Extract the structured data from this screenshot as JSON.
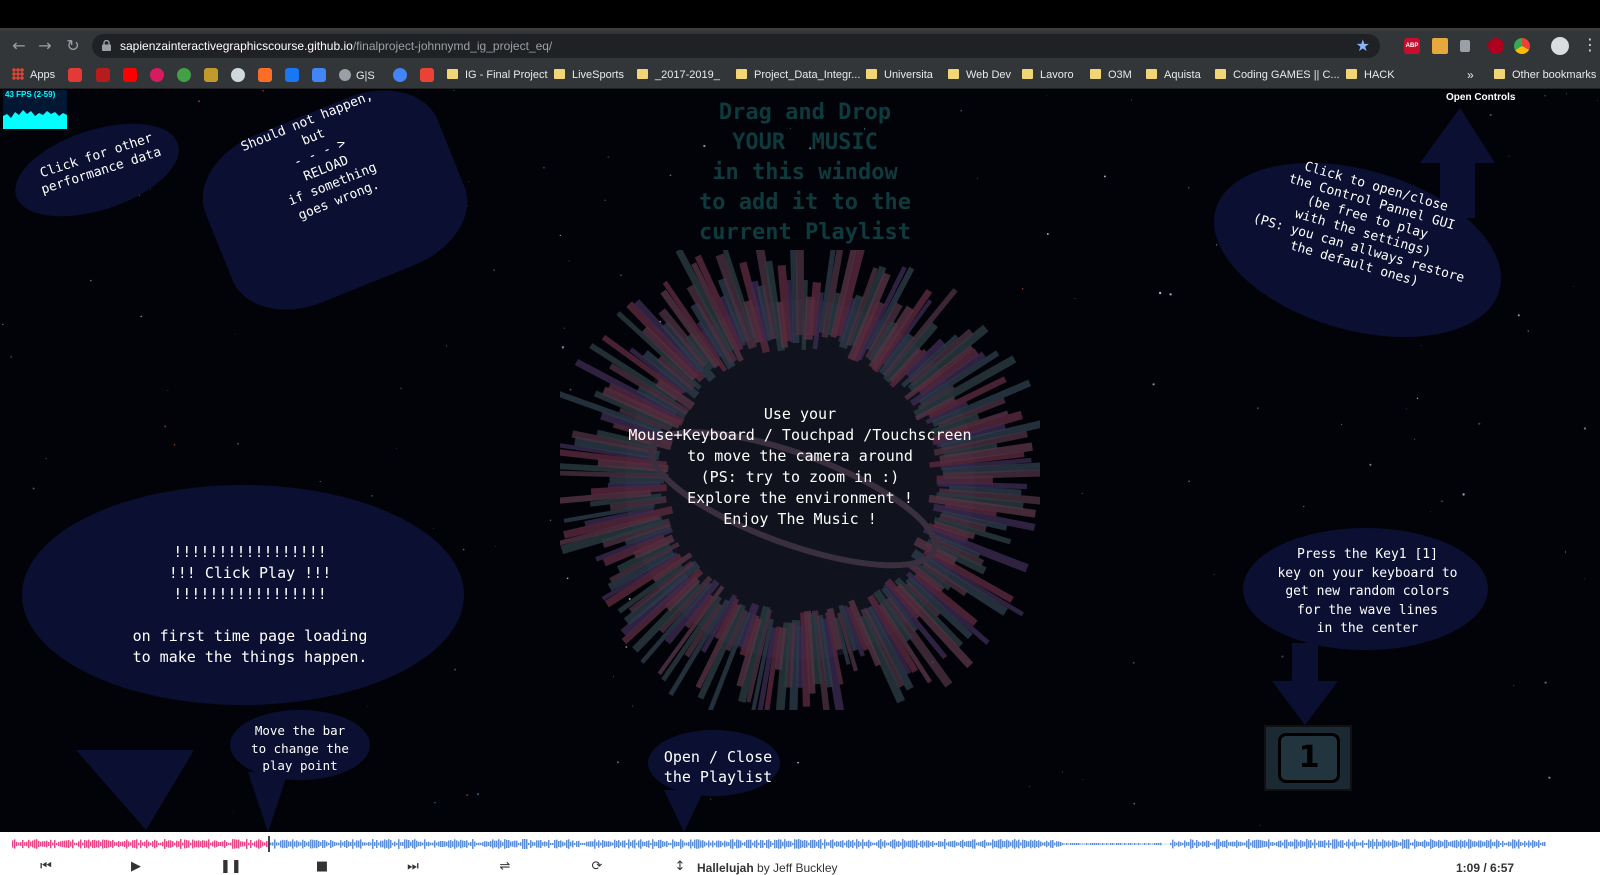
{
  "browser": {
    "url_host": "sapienzainteractivegraphicscourse.github.io",
    "url_path": "/finalproject-johnnymd_ig_project_eq/",
    "bookmarks": {
      "apps": "Apps",
      "gis": "G|S",
      "folders": [
        "IG - Final Project",
        "LiveSports",
        "_2017-2019_",
        "Project_Data_Integr...",
        "Universita",
        "Web Dev",
        "Lavoro",
        "O3M",
        "Aquista",
        "Coding GAMES || C...",
        "HACK"
      ],
      "more": "»",
      "other": "Other bookmarks"
    },
    "extension_abp": "ABP"
  },
  "app": {
    "fps_label": "43 FPS (2-59)",
    "open_controls": "Open Controls",
    "drag_drop": "Drag and Drop\nYOUR  MUSIC\nin this window\nto add it to the\ncurrent Playlist",
    "tip_performance": "Click for other\nperformance data",
    "tip_reload": "Should not happen,\nbut\n- - - >\nRELOAD\nif something\ngoes wrong.",
    "tip_controls": "Click to open/close\nthe Control Pannel GUI\n(be free to play\nwith the settings)\n(PS: you can allways restore\nthe default ones)",
    "center_text": "Use your\nMouse+Keyboard / Touchpad /Touchscreen\nto move the camera around\n(PS: try to zoom in :)\nExplore the environment !\nEnjoy The Music !",
    "tip_play": "!!!!!!!!!!!!!!!!!\n!!! Click Play !!!\n!!!!!!!!!!!!!!!!!\n\non first time page loading\nto make the things happen.",
    "tip_key1": "Press the Key1 [1]\nkey on your keyboard to\nget new random colors\nfor the wave lines\nin the center",
    "tip_bar": "Move the bar\nto change the\nplay point",
    "tip_playlist": "Open / Close\nthe Playlist",
    "key1_label": "1",
    "bubble_color": "#0b1033"
  },
  "player": {
    "track_title": "Hallelujah",
    "track_by": " by Jeff Buckley",
    "time": "1:09 / 6:57",
    "progress": 0.167,
    "played_color": "#e8488a",
    "remaining_color": "#5b8fd8",
    "controls": [
      "prev-icon",
      "play-icon",
      "pause-icon",
      "stop-icon",
      "next-icon",
      "shuffle-icon",
      "repeat-icon",
      "playlist-toggle-icon"
    ]
  }
}
